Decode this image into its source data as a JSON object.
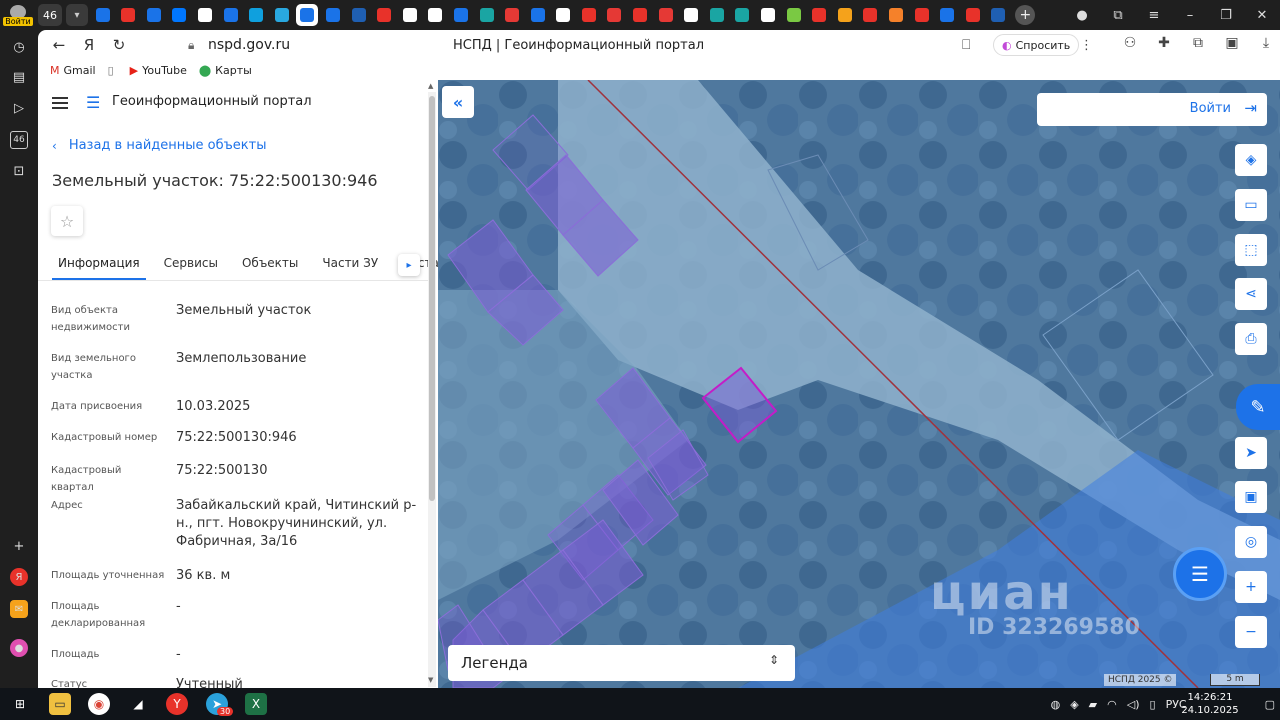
{
  "browser": {
    "profile_label": "Войти",
    "tab_count": "46",
    "url": "nspd.gov.ru",
    "page_title": "НСПД | Геоинформационный портал",
    "ask_label": "Спросить"
  },
  "bookmarks": [
    {
      "label": "Gmail",
      "icon": "gmail-icon"
    },
    {
      "label": "",
      "icon": "page-icon"
    },
    {
      "label": "YouTube",
      "icon": "youtube-icon"
    },
    {
      "label": "Карты",
      "icon": "maps-pin-icon"
    }
  ],
  "sidebar": {
    "tab_badge": "46"
  },
  "panel": {
    "portal_name": "Геоинформационный портал",
    "back_link": "Назад в найденные объекты",
    "object_title": "Земельный участок: 75:22:500130:946",
    "tabs": [
      "Информация",
      "Сервисы",
      "Объекты",
      "Части ЗУ",
      "Соста"
    ],
    "fields": [
      {
        "key": "Вид объекта недвижимости",
        "value": "Земельный участок"
      },
      {
        "key": "Вид земельного участка",
        "value": "Землепользование"
      },
      {
        "key": "Дата присвоения",
        "value": "10.03.2025"
      },
      {
        "key": "Кадастровый номер",
        "value": "75:22:500130:946"
      },
      {
        "key": "Кадастровый квартал",
        "value": "75:22:500130"
      },
      {
        "key": "Адрес",
        "value": "Забайкальский край, Читинский р-н., пгт. Новокручининский, ул. Фабричная, 3а/16"
      },
      {
        "key": "Площадь уточненная",
        "value": "36 кв. м"
      },
      {
        "key": "Площадь декларированная",
        "value": "-"
      },
      {
        "key": "Площадь",
        "value": "-"
      },
      {
        "key": "Статус",
        "value": "Учтенный"
      }
    ]
  },
  "map": {
    "login_label": "Войти",
    "legend_label": "Легенда",
    "watermark_big": "циан",
    "watermark_small": "ID 323269580",
    "copyright": "НСПД 2025 ©",
    "scale": "5 m"
  },
  "taskbar": {
    "time": "14:26:21",
    "date": "24.10.2025",
    "lang": "РУС",
    "telegram_badge": "30"
  },
  "colors": {
    "accent": "#1d72e8",
    "parcel_fill": "#7b5cd6",
    "selected_parcel_border": "#c41cc8",
    "boundary_line": "#a0323c"
  }
}
